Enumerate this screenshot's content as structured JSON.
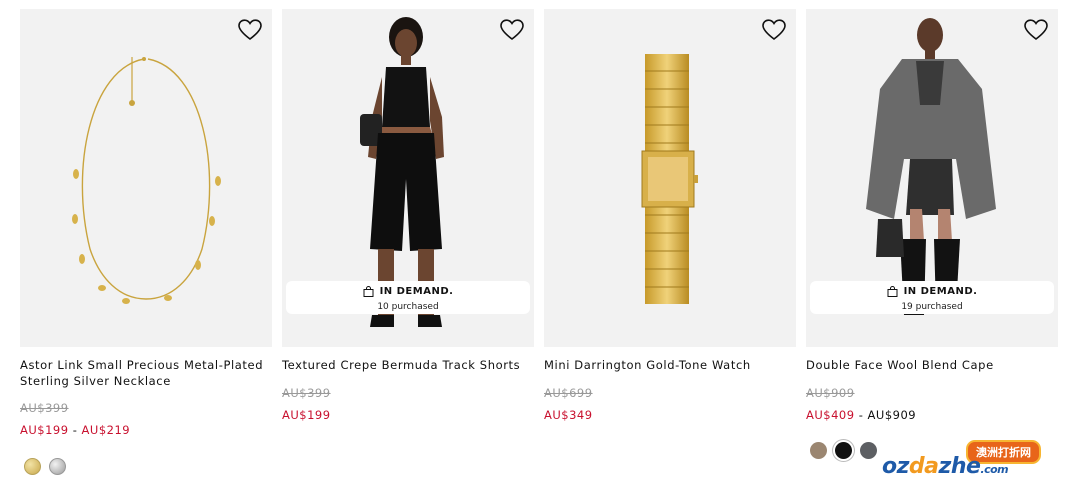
{
  "products": [
    {
      "name": "Astor Link Small Precious Metal-Plated Sterling Silver Necklace",
      "original_price": "AU$399",
      "sale_price": "AU$199",
      "sale_separator": " - ",
      "sale_price_max": "AU$219",
      "badge": null,
      "swatches": [
        {
          "name": "gold",
          "color": "#d9c27a"
        },
        {
          "name": "silver",
          "color": "#bdbdbd"
        }
      ]
    },
    {
      "name": "Textured Crepe Bermuda Track Shorts",
      "original_price": "AU$399",
      "sale_price": "AU$199",
      "badge": {
        "title": "IN DEMAND.",
        "subtitle": "10 purchased"
      }
    },
    {
      "name": "Mini Darrington Gold-Tone Watch",
      "original_price": "AU$699",
      "sale_price": "AU$349",
      "badge": null
    },
    {
      "name": "Double Face Wool Blend Cape",
      "original_price": "AU$909",
      "sale_price": "AU$409",
      "sale_separator": " - ",
      "sale_price_max": "AU$909",
      "badge": {
        "title": "IN DEMAND.",
        "subtitle": "19 purchased"
      },
      "swatches": [
        {
          "name": "camel",
          "color": "#9b8671"
        },
        {
          "name": "black",
          "color": "#111111"
        },
        {
          "name": "grey",
          "color": "#5d5f63"
        }
      ]
    }
  ],
  "watermark": {
    "tag": "澳洲打折网",
    "brand_left": "oz",
    "brand_mid": "da",
    "brand_right": "zhe",
    "suffix": ".com"
  },
  "colors": {
    "sale": "#c8102e",
    "strike": "#999999",
    "tile_bg": "#f2f2f2"
  }
}
